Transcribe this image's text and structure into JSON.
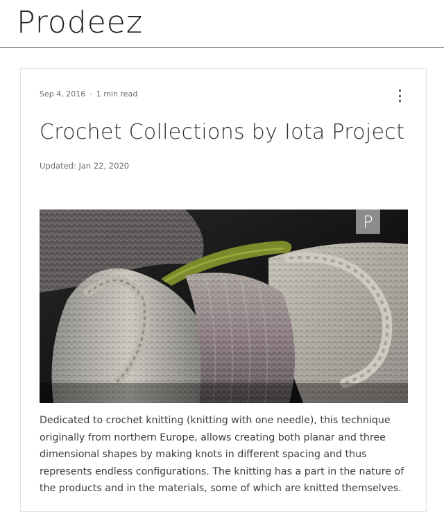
{
  "site": {
    "logo": "Prodeez"
  },
  "post": {
    "date": "Sep 4, 2016",
    "separator": "·",
    "read_time": "1 min read",
    "menu_icon": "more-vertical-icon",
    "title": "Crochet Collections by Iota Project",
    "updated": "Updated: Jan 22, 2020",
    "image_watermark": "P",
    "body": "Dedicated to crochet knitting (knitting with one needle), this technique originally from northern Europe, allows creating both planar and three dimensional shapes by making knots in different spacing and thus represents endless configurations. The knitting has a part in the nature of the products and in the materials, some of which are knitted themselves."
  },
  "colors": {
    "text": "#2f2e2e",
    "muted": "#6b6b6b",
    "divider": "#9a9a9a",
    "card_border": "#e2e2e2"
  }
}
